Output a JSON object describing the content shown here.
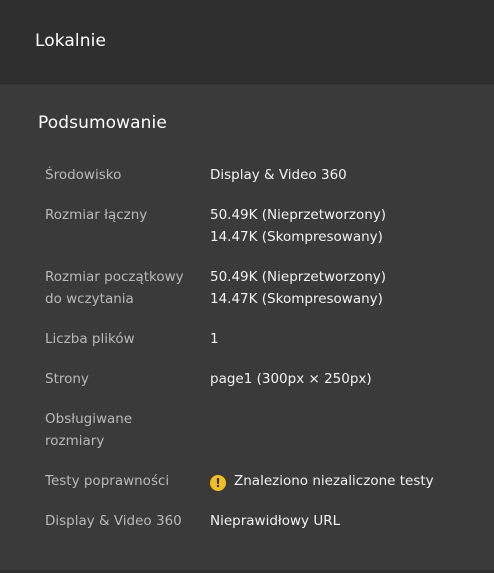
{
  "header": {
    "title": "Lokalnie"
  },
  "summary": {
    "title": "Podsumowanie",
    "rows": [
      {
        "label": "Środowisko",
        "lines": [
          "Display & Video 360"
        ]
      },
      {
        "label": "Rozmiar łączny",
        "lines": [
          "50.49K (Nieprzetworzony)",
          "14.47K (Skompresowany)"
        ]
      },
      {
        "label": "Rozmiar początkowy do wczytania",
        "lines": [
          "50.49K (Nieprzetworzony)",
          "14.47K (Skompresowany)"
        ]
      },
      {
        "label": "Liczba plików",
        "lines": [
          "1"
        ]
      },
      {
        "label": "Strony",
        "lines": [
          "page1 (300px × 250px)"
        ]
      },
      {
        "label": "Obsługiwane rozmiary",
        "lines": []
      },
      {
        "label": "Testy poprawności",
        "warning_icon": "warning-icon",
        "warning_text": "Znaleziono niezaliczone testy"
      },
      {
        "label": "Display & Video 360",
        "lines": [
          "Nieprawidłowy URL"
        ]
      }
    ]
  }
}
